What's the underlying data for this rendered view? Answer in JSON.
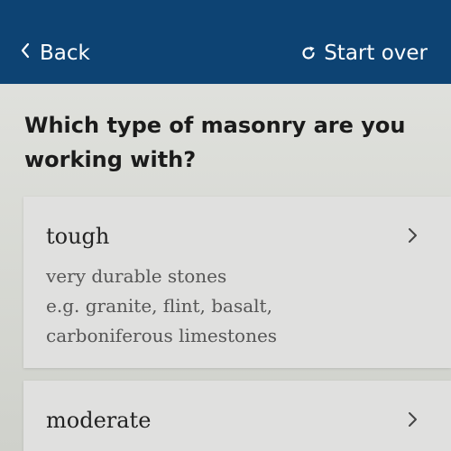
{
  "header": {
    "back_label": "Back",
    "start_over_label": "Start over",
    "background_color": "#0d4373",
    "back_icon": "chevron-left-icon",
    "start_over_icon": "refresh-icon"
  },
  "question": {
    "title": "Which type of masonry are you working with?"
  },
  "options": [
    {
      "title": "tough",
      "description_lines": [
        "very durable stones",
        "e.g. granite, flint, basalt,",
        "carboniferous limestones"
      ],
      "icon": "chevron-right-icon"
    },
    {
      "title": "moderate",
      "icon": "chevron-right-icon"
    }
  ]
}
